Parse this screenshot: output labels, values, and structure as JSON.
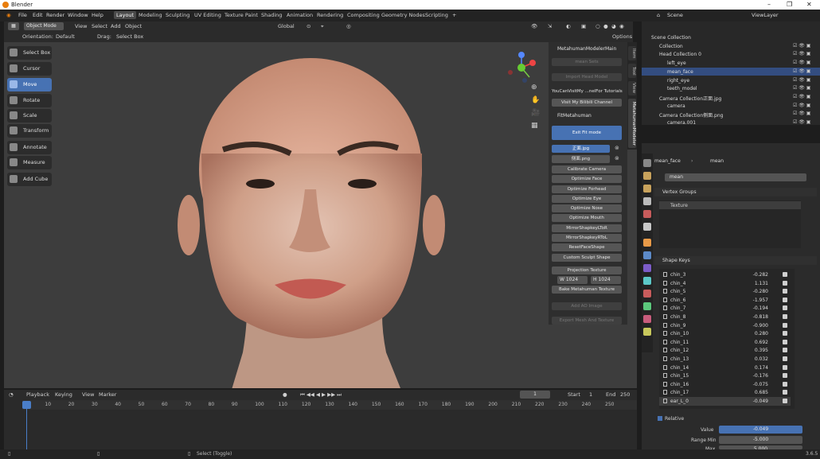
{
  "window": {
    "title": "Blender",
    "controls": [
      "–",
      "❐",
      "✕"
    ]
  },
  "menu": {
    "items": [
      "File",
      "Edit",
      "Render",
      "Window",
      "Help"
    ]
  },
  "workspaces": {
    "tabs": [
      "Layout",
      "Modeling",
      "Sculpting",
      "UV Editing",
      "Texture Paint",
      "Shading",
      "Animation",
      "Rendering",
      "Compositing",
      "Geometry Nodes",
      "Scripting"
    ],
    "active": "Layout"
  },
  "scene": {
    "label": "Scene",
    "view_layer": "ViewLayer"
  },
  "viewport_header": {
    "mode": "Object Mode",
    "view": "View",
    "select": "Select",
    "add": "Add",
    "object": "Object",
    "transform": "Global",
    "orientation_label": "Orientation:",
    "orientation_value": "Default",
    "drag_label": "Drag:",
    "drag_value": "Select Box",
    "options": "Options"
  },
  "tools": [
    "Select Box",
    "Cursor",
    "Move",
    "Rotate",
    "Scale",
    "Transform",
    "Annotate",
    "Measure",
    "Add Cube"
  ],
  "active_tool": "Move",
  "npanel": {
    "panel1_title": "MetahumanModelerMain",
    "mean_sets": "mean Sets",
    "import_head": "Import Head Model",
    "tutorial": "YouCanVisitMy ...nelFor Tutorials",
    "bilibili": "Visit My Bilibili Channel",
    "panel2_title": "FitMetahuman",
    "exit_fit": "Exit Fit mode",
    "img_front": "正面.jpg",
    "img_side": "侧面.png",
    "buttons": [
      "Calibrate Camera",
      "Optimize Face",
      "Optimize Forhead",
      "Optimize Eye",
      "Optimize Nose",
      "Optimize Mouth",
      "MirrorShapkeyLToR",
      "MirrorShapkeyRToL",
      "ResetFaceShape",
      "Custom Sculpt Shape"
    ],
    "projection": "Projection Texture",
    "w_label": "W",
    "w_value": "1024",
    "h_label": "H",
    "h_value": "1024",
    "bake": "Bake Metahuman Texture",
    "add_ao": "Add AO Image",
    "export": "Export Mesh And Texture"
  },
  "side_tabs": [
    "Item",
    "Tool",
    "View",
    "MetahumanModeler"
  ],
  "outliner": {
    "rows": [
      {
        "name": "Scene Collection",
        "indent": 0
      },
      {
        "name": "Collection",
        "indent": 1
      },
      {
        "name": "Head Collection 0",
        "indent": 1
      },
      {
        "name": "left_eye",
        "indent": 2
      },
      {
        "name": "mean_face",
        "indent": 2,
        "selected": true
      },
      {
        "name": "right_eye",
        "indent": 2
      },
      {
        "name": "teeth_model",
        "indent": 2
      },
      {
        "name": "Camera Collection正面.jpg",
        "indent": 1
      },
      {
        "name": "camera",
        "indent": 2
      },
      {
        "name": "Camera Collection侧面.png",
        "indent": 1
      },
      {
        "name": "camera.001",
        "indent": 2
      }
    ]
  },
  "properties": {
    "object": "mean_face",
    "mesh": "mean",
    "mesh_field": "mean",
    "vertex_groups": "Vertex Groups",
    "vg_item": "Texture",
    "shape_keys": "Shape Keys",
    "keys": [
      {
        "n": "chin_3",
        "v": "-0.282"
      },
      {
        "n": "chin_4",
        "v": "1.131"
      },
      {
        "n": "chin_5",
        "v": "-0.280"
      },
      {
        "n": "chin_6",
        "v": "-1.957"
      },
      {
        "n": "chin_7",
        "v": "-0.194"
      },
      {
        "n": "chin_8",
        "v": "-0.818"
      },
      {
        "n": "chin_9",
        "v": "-0.900"
      },
      {
        "n": "chin_10",
        "v": "0.280"
      },
      {
        "n": "chin_11",
        "v": "0.692"
      },
      {
        "n": "chin_12",
        "v": "0.395"
      },
      {
        "n": "chin_13",
        "v": "0.032"
      },
      {
        "n": "chin_14",
        "v": "0.174"
      },
      {
        "n": "chin_15",
        "v": "-0.176"
      },
      {
        "n": "chin_16",
        "v": "-0.075"
      },
      {
        "n": "chin_17",
        "v": "0.685"
      },
      {
        "n": "ear_L_0",
        "v": "-0.049"
      }
    ],
    "relative": "Relative",
    "value_label": "Value",
    "value": "-0.049",
    "range_min_label": "Range Min",
    "range_min": "-5.000",
    "max_label": "Max",
    "max": "5.000"
  },
  "timeline": {
    "playback": "Playback",
    "keying": "Keying",
    "view": "View",
    "marker": "Marker",
    "current_frame": "1",
    "start_label": "Start",
    "start": "1",
    "end_label": "End",
    "end": "250",
    "ticks": [
      "1",
      "10",
      "20",
      "30",
      "40",
      "50",
      "60",
      "70",
      "80",
      "90",
      "100",
      "110",
      "120",
      "130",
      "140",
      "150",
      "160",
      "170",
      "180",
      "190",
      "200",
      "210",
      "220",
      "230",
      "240",
      "250"
    ]
  },
  "status": {
    "select_hint": "Select (Toggle)",
    "version": "3.6.5"
  }
}
